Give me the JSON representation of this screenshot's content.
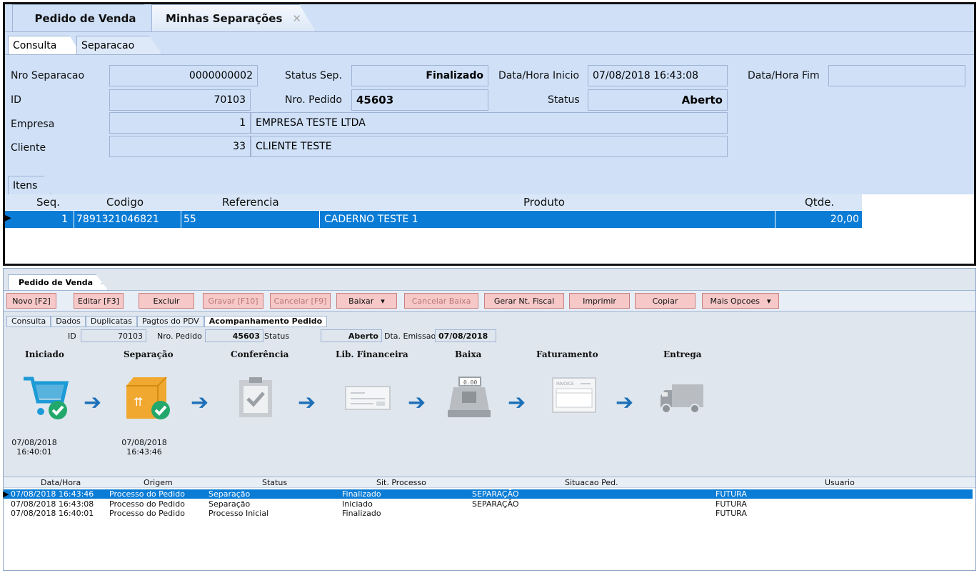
{
  "top": {
    "tabs": [
      "Pedido de Venda",
      "Minhas Separações"
    ],
    "subtabs": [
      "Consulta",
      "Separacao"
    ],
    "fields": {
      "nro_sep_label": "Nro Separacao",
      "nro_sep": "0000000002",
      "status_sep_label": "Status Sep.",
      "status_sep": "Finalizado",
      "dh_inicio_label": "Data/Hora Inicio",
      "dh_inicio": "07/08/2018 16:43:08",
      "dh_fim_label": "Data/Hora Fim",
      "dh_fim": "",
      "id_label": "ID",
      "id": "70103",
      "nro_pedido_label": "Nro. Pedido",
      "nro_pedido": "45603",
      "status_label": "Status",
      "status": "Aberto",
      "empresa_label": "Empresa",
      "empresa_id": "1",
      "empresa_nome": "EMPRESA TESTE LTDA",
      "cliente_label": "Cliente",
      "cliente_id": "33",
      "cliente_nome": "CLIENTE TESTE"
    },
    "itens_tab": "Itens",
    "grid_headers": [
      "Seq.",
      "Codigo",
      "Referencia",
      "Produto",
      "Qtde."
    ],
    "grid_row": {
      "seq": "1",
      "codigo": "7891321046821",
      "referencia": "55",
      "produto": "CADERNO TESTE 1",
      "qtde": "20,00"
    }
  },
  "bottom": {
    "tab": "Pedido de Venda",
    "buttons": [
      "Novo [F2]",
      "Editar [F3]",
      "Excluir",
      "Gravar [F10]",
      "Cancelar [F9]",
      "Baixar",
      "Cancelar Baixa",
      "Gerar Nt. Fiscal",
      "Imprimir",
      "Copiar",
      "Mais Opcoes"
    ],
    "subtabs": [
      "Consulta",
      "Dados",
      "Duplicatas",
      "Pagtos do PDV",
      "Acompanhamento Pedido"
    ],
    "info": {
      "id_label": "ID",
      "id": "70103",
      "nro_label": "Nro. Pedido",
      "nro": "45603",
      "status_label": "Status",
      "status": "Aberto",
      "emissao_label": "Dta. Emissao",
      "emissao": "07/08/2018"
    },
    "steps": [
      "Iniciado",
      "Separação",
      "Conferência",
      "Lib. Financeira",
      "Baixa",
      "Faturamento",
      "Entrega"
    ],
    "step_times": [
      [
        "07/08/2018",
        "16:40:01"
      ],
      [
        "07/08/2018",
        "16:43:46"
      ]
    ],
    "history_headers": [
      "Data/Hora",
      "Origem",
      "Status",
      "Sit. Processo",
      "Situacao Ped.",
      "Usuario"
    ],
    "history": [
      [
        "07/08/2018 16:43:46",
        "Processo do Pedido",
        "Separação",
        "Finalizado",
        "SEPARAÇÃO",
        "FUTURA"
      ],
      [
        "07/08/2018 16:43:08",
        "Processo do Pedido",
        "Separação",
        "Iniciado",
        "SEPARAÇÃO",
        "FUTURA"
      ],
      [
        "07/08/2018 16:40:01",
        "Processo do Pedido",
        "Processo Inicial",
        "Finalizado",
        "",
        "FUTURA"
      ]
    ],
    "icons": [
      "cart-check-icon",
      "box-check-icon",
      "clipboard-check-icon",
      "check-document-icon",
      "cash-register-icon",
      "invoice-icon",
      "truck-icon"
    ]
  },
  "colors": {
    "accent": "#0a7cd6",
    "check": "#22a86b",
    "arrow": "#1d70b8"
  }
}
